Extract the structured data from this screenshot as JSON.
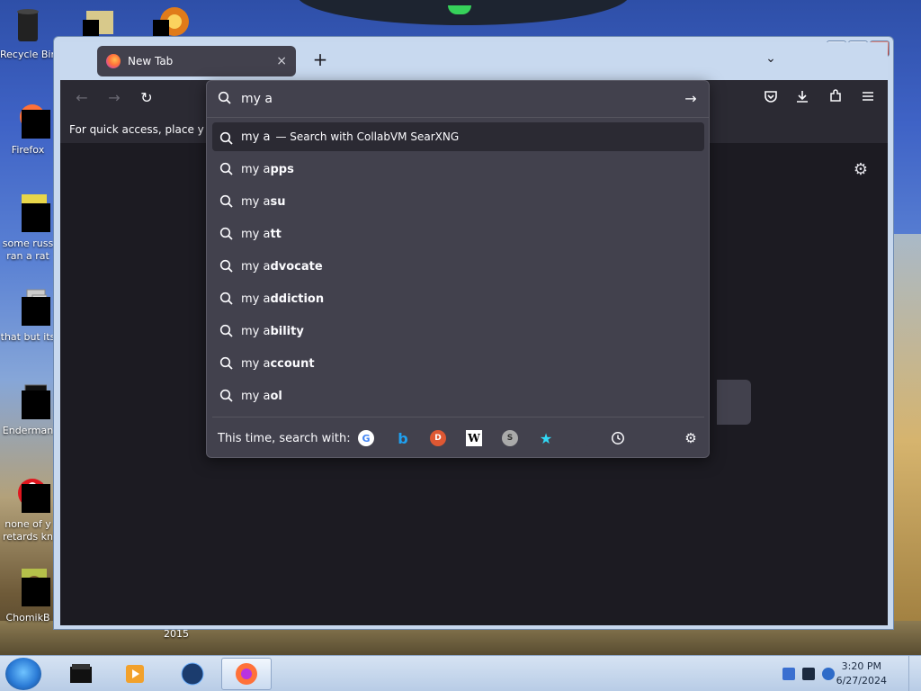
{
  "desktop": {
    "icons": [
      {
        "label": "Recycle Bin"
      },
      {
        "label": "Firefox"
      },
      {
        "label": "some russ ran a rat"
      },
      {
        "label": "that but its"
      },
      {
        "label": "Enderman"
      },
      {
        "label": "none of y retards kn"
      },
      {
        "label": "ChomikB"
      }
    ],
    "caption_2015": "2015"
  },
  "browser": {
    "tab": {
      "title": "New Tab",
      "close_glyph": "×"
    },
    "newtab_glyph": "+",
    "tablist_glyph": "⌄",
    "caption": {
      "minimize": "▁",
      "maximize": "□",
      "close": "✕"
    },
    "nav": {
      "back": "←",
      "forward": "→",
      "reload": "↻"
    },
    "bookmarks_text": "For quick access, place your bookmarks here on the bookmarks toolbar.",
    "page_gear": "⚙",
    "urlbar": {
      "value": "my a",
      "go": "→",
      "heuristic": {
        "typed": "my a",
        "action": "— Search with CollabVM SearXNG"
      },
      "suggestions": [
        {
          "typed": "my a",
          "rest": "pps"
        },
        {
          "typed": "my a",
          "rest": "su"
        },
        {
          "typed": "my a",
          "rest": "tt"
        },
        {
          "typed": "my a",
          "rest": "dvocate"
        },
        {
          "typed": "my a",
          "rest": "ddiction"
        },
        {
          "typed": "my a",
          "rest": "bility"
        },
        {
          "typed": "my a",
          "rest": "ccount"
        },
        {
          "typed": "my a",
          "rest": "ol"
        }
      ],
      "oneoff_label": "This time, search with:",
      "oneoff_engines": {
        "google": "G",
        "bing": "b",
        "ddg": "D",
        "wiki": "W",
        "searx": "S",
        "star": "★",
        "gear": "⚙"
      }
    }
  },
  "taskbar": {
    "time": "3:20 PM",
    "date": "6/27/2024"
  }
}
